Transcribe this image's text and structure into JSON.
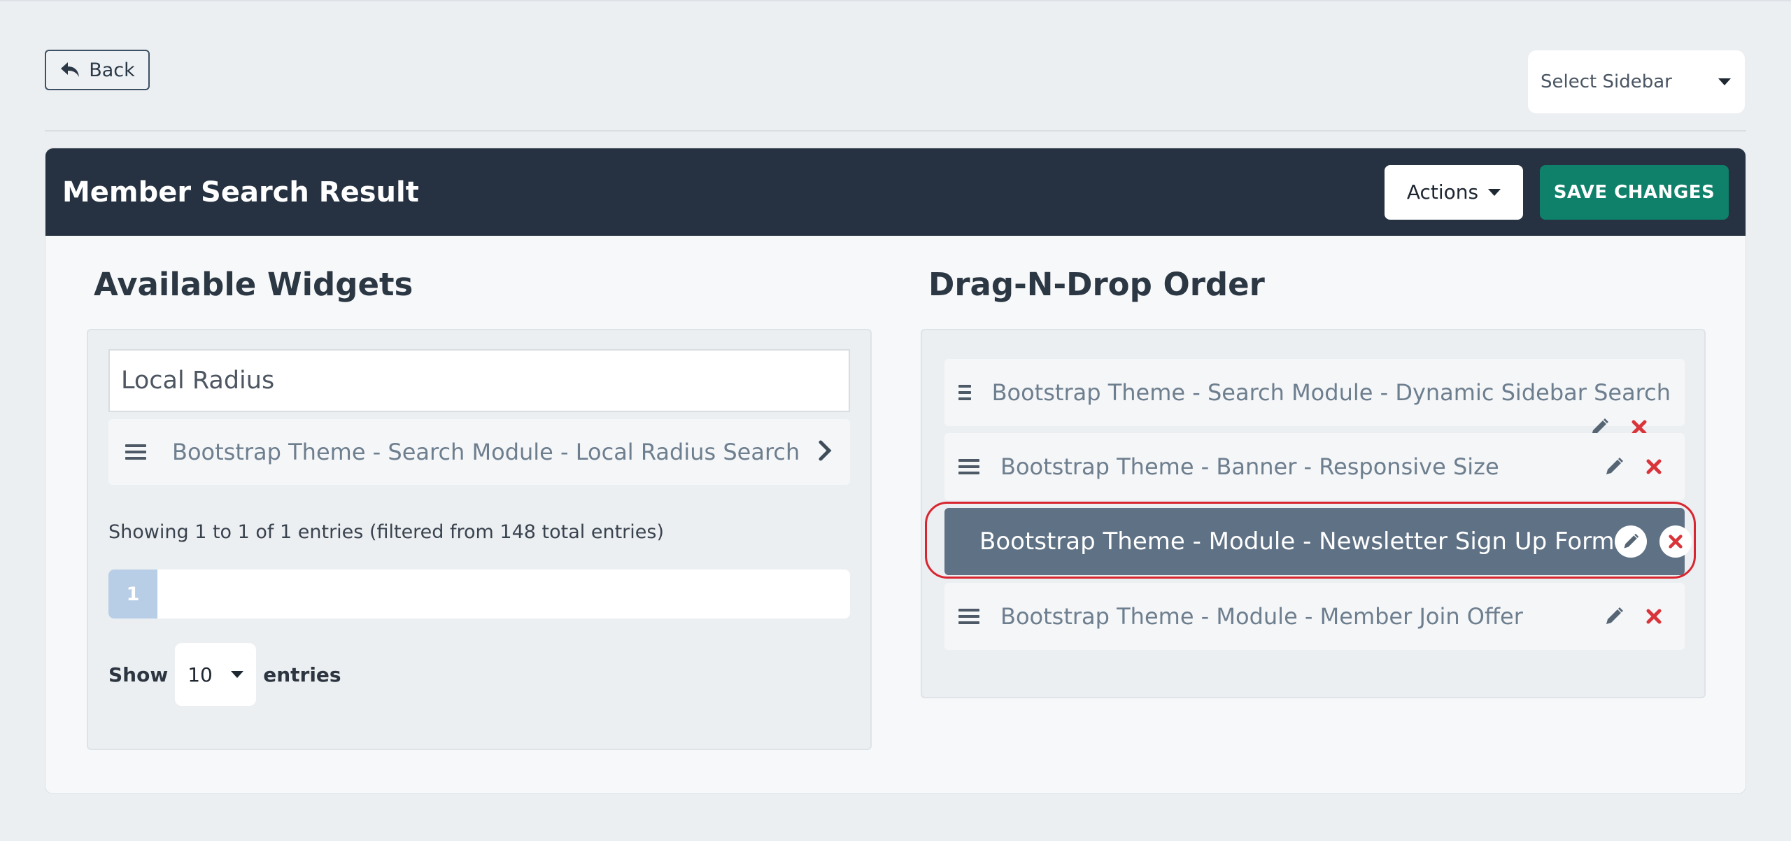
{
  "top": {
    "back_label": "Back",
    "sidebar_select_value": "Select Sidebar"
  },
  "panel": {
    "title": "Member Search Result",
    "actions_label": "Actions",
    "save_label": "SAVE CHANGES"
  },
  "available": {
    "heading": "Available Widgets",
    "search_value": "Local Radius",
    "results": [
      {
        "label": "Bootstrap Theme - Search Module - Local Radius Search"
      }
    ],
    "info": "Showing 1 to 1 of 1 entries (filtered from 148 total entries)",
    "current_page": "1",
    "show_label": "Show",
    "page_length": "10",
    "entries_label": "entries"
  },
  "order": {
    "heading": "Drag-N-Drop Order",
    "items": [
      {
        "label": "Bootstrap Theme - Search Module - Dynamic Sidebar Search"
      },
      {
        "label": "Bootstrap Theme - Banner - Responsive Size"
      },
      {
        "label": "Bootstrap Theme - Module - Newsletter Sign Up Form",
        "selected": true
      },
      {
        "label": "Bootstrap Theme - Module - Member Join Offer"
      }
    ]
  },
  "colors": {
    "header_bg": "#263241",
    "save_bg": "#0f806a",
    "selected_row_bg": "#5e7185",
    "delete_red": "#d9343a",
    "highlight_ring": "#d82630"
  },
  "icons": {
    "back": "reply-arrow-icon",
    "drag": "hamburger-drag-icon",
    "edit": "pencil-icon",
    "delete": "close-x-icon",
    "open": "chevron-right-icon",
    "dropdown": "caret-down-icon"
  }
}
